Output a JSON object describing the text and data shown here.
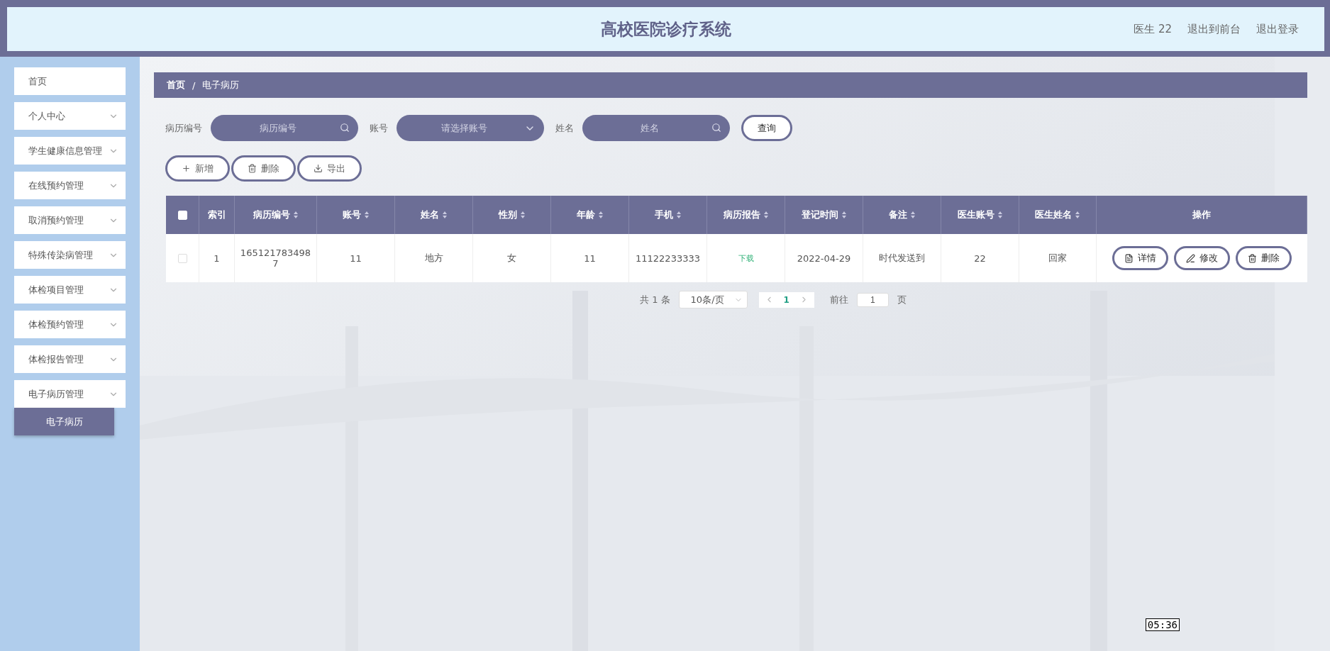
{
  "header": {
    "title": "高校医院诊疗系统",
    "user": "医生 22",
    "links": [
      "退出到前台",
      "退出登录"
    ]
  },
  "sidebar": {
    "items": [
      {
        "label": "首页",
        "expandable": false
      },
      {
        "label": "个人中心",
        "expandable": true
      },
      {
        "label": "学生健康信息管理",
        "expandable": true
      },
      {
        "label": "在线预约管理",
        "expandable": true
      },
      {
        "label": "取消预约管理",
        "expandable": true
      },
      {
        "label": "特殊传染病管理",
        "expandable": true
      },
      {
        "label": "体检项目管理",
        "expandable": true
      },
      {
        "label": "体检预约管理",
        "expandable": true
      },
      {
        "label": "体检报告管理",
        "expandable": true
      },
      {
        "label": "电子病历管理",
        "expandable": true,
        "children": [
          {
            "label": "电子病历",
            "selected": true
          }
        ]
      }
    ]
  },
  "breadcrumb": [
    "首页",
    "/",
    "电子病历"
  ],
  "search": {
    "fields": [
      {
        "kind": "input",
        "label": "病历编号",
        "placeholder": "病历编号"
      },
      {
        "kind": "select",
        "label": "账号",
        "placeholder": "请选择账号"
      },
      {
        "kind": "input",
        "label": "姓名",
        "placeholder": "姓名"
      }
    ],
    "button": "查询"
  },
  "actions": [
    {
      "kind": "add",
      "label": "新增"
    },
    {
      "kind": "delete",
      "label": "删除"
    },
    {
      "kind": "export",
      "label": "导出"
    }
  ],
  "table": {
    "select_all_checked": false,
    "columns": [
      {
        "label": "索引",
        "sortable": false
      },
      {
        "label": "病历编号",
        "sortable": true
      },
      {
        "label": "账号",
        "sortable": true
      },
      {
        "label": "姓名",
        "sortable": true
      },
      {
        "label": "性别",
        "sortable": true
      },
      {
        "label": "年龄",
        "sortable": true
      },
      {
        "label": "手机",
        "sortable": true
      },
      {
        "label": "病历报告",
        "sortable": true
      },
      {
        "label": "登记时间",
        "sortable": true
      },
      {
        "label": "备注",
        "sortable": true
      },
      {
        "label": "医生账号",
        "sortable": true
      },
      {
        "label": "医生姓名",
        "sortable": true
      },
      {
        "label": "操作",
        "sortable": false
      }
    ],
    "rows": [
      {
        "checked": false,
        "cells": [
          "1",
          "1651217834987",
          "11",
          "地方",
          "女",
          "11",
          "11122233333",
          "下载",
          "2022-04-29",
          "时代发送到",
          "22",
          "回家"
        ],
        "buttons": [
          {
            "kind": "detail",
            "label": "详情"
          },
          {
            "kind": "edit",
            "label": "修改"
          },
          {
            "kind": "delete",
            "label": "删除"
          }
        ]
      }
    ]
  },
  "pagination": {
    "total": "共 1 条",
    "page_size": "10条/页",
    "pages": [
      {
        "label": "1",
        "selected": true
      }
    ],
    "goto_label": "前往",
    "goto_value": "1",
    "goto_suffix": "页"
  },
  "time_tooltip": "05:36"
}
